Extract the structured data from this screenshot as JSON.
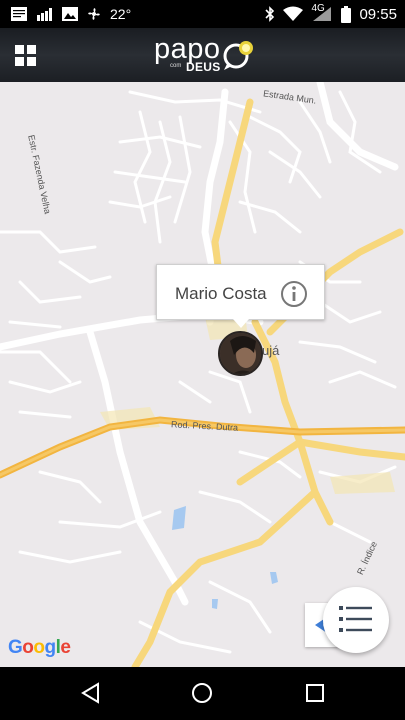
{
  "status_bar": {
    "temperature": "22°",
    "network": "4G",
    "time": "09:55",
    "icons": [
      "notification-icon",
      "signal-bars-icon",
      "image-icon",
      "fan-icon",
      "bluetooth-icon",
      "wifi-icon",
      "cell-signal-icon",
      "battery-icon"
    ]
  },
  "header": {
    "logo_main": "papo",
    "logo_small": "com",
    "logo_sub": "DEUS",
    "menu_icon": "grid-menu-icon"
  },
  "map": {
    "labels": {
      "estrada_mun": "Estrada Mun.",
      "estr_fazenda": "Estr. Fazenda Velha",
      "rod_dutra": "Rod. Pres. Dutra",
      "town_partial": "ujá",
      "r_indice": "R. Índice"
    },
    "colors": {
      "background": "#ece9eb",
      "minor_road": "#ffffff",
      "major_road": "#f7d77c",
      "highway": "#f4b843",
      "water": "#a6c9f0"
    },
    "google_logo": {
      "letters": [
        "G",
        "o",
        "o",
        "g",
        "l",
        "e"
      ],
      "colors": [
        "#4285F4",
        "#EA4335",
        "#FBBC05",
        "#4285F4",
        "#34A853",
        "#EA4335"
      ]
    }
  },
  "popup": {
    "name": "Mario Costa",
    "info_icon": "info-icon"
  },
  "marker": {
    "avatar_icon": "user-avatar"
  },
  "controls": {
    "navigate_icon": "navigation-arrow-icon",
    "list_icon": "list-icon"
  },
  "nav_bar": {
    "back_icon": "back-triangle-icon",
    "home_icon": "home-circle-icon",
    "recents_icon": "recents-square-icon"
  }
}
